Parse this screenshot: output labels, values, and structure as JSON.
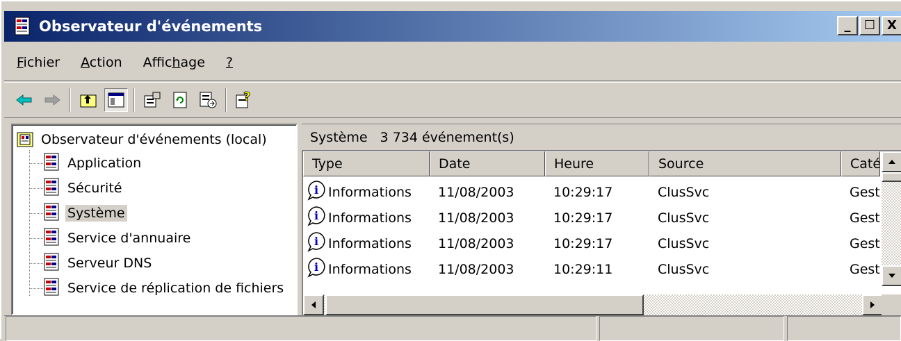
{
  "window": {
    "title": "Observateur d'événements",
    "controls": {
      "minimize": "_",
      "maximize": "☐",
      "close": "X"
    }
  },
  "menu": [
    {
      "label": "Fichier",
      "hotkey_index": 0
    },
    {
      "label": "Action",
      "hotkey_index": 0
    },
    {
      "label": "Affichage",
      "hotkey_index": 5
    },
    {
      "label": "?",
      "hotkey_index": 0
    }
  ],
  "toolbar": {
    "buttons": [
      "back-arrow-icon",
      "forward-arrow-icon",
      "up-folder-icon",
      "show-hide-tree-icon",
      "properties-icon",
      "refresh-icon",
      "export-list-icon",
      "help-icon"
    ]
  },
  "tree": {
    "root": "Observateur d'événements (local)",
    "items": [
      {
        "label": "Application",
        "selected": false
      },
      {
        "label": "Sécurité",
        "selected": false
      },
      {
        "label": "Système",
        "selected": true
      },
      {
        "label": "Service d'annuaire",
        "selected": false
      },
      {
        "label": "Serveur DNS",
        "selected": false
      },
      {
        "label": "Service de réplication de fichiers",
        "selected": false
      }
    ]
  },
  "list": {
    "header_title": "Système",
    "header_count": "3 734 événement(s)",
    "columns": [
      "Type",
      "Date",
      "Heure",
      "Source",
      "Catégorie"
    ],
    "rows": [
      [
        "Informations",
        "11/08/2003",
        "10:29:17",
        "ClusSvc",
        "Gestion"
      ],
      [
        "Informations",
        "11/08/2003",
        "10:29:17",
        "ClusSvc",
        "Gestion"
      ],
      [
        "Informations",
        "11/08/2003",
        "10:29:17",
        "ClusSvc",
        "Gestion"
      ],
      [
        "Informations",
        "11/08/2003",
        "10:29:11",
        "ClusSvc",
        "Gestion"
      ]
    ]
  },
  "colors": {
    "title_start": "#0a246a",
    "title_end": "#a6caf0",
    "face": "#d4d0c8"
  }
}
